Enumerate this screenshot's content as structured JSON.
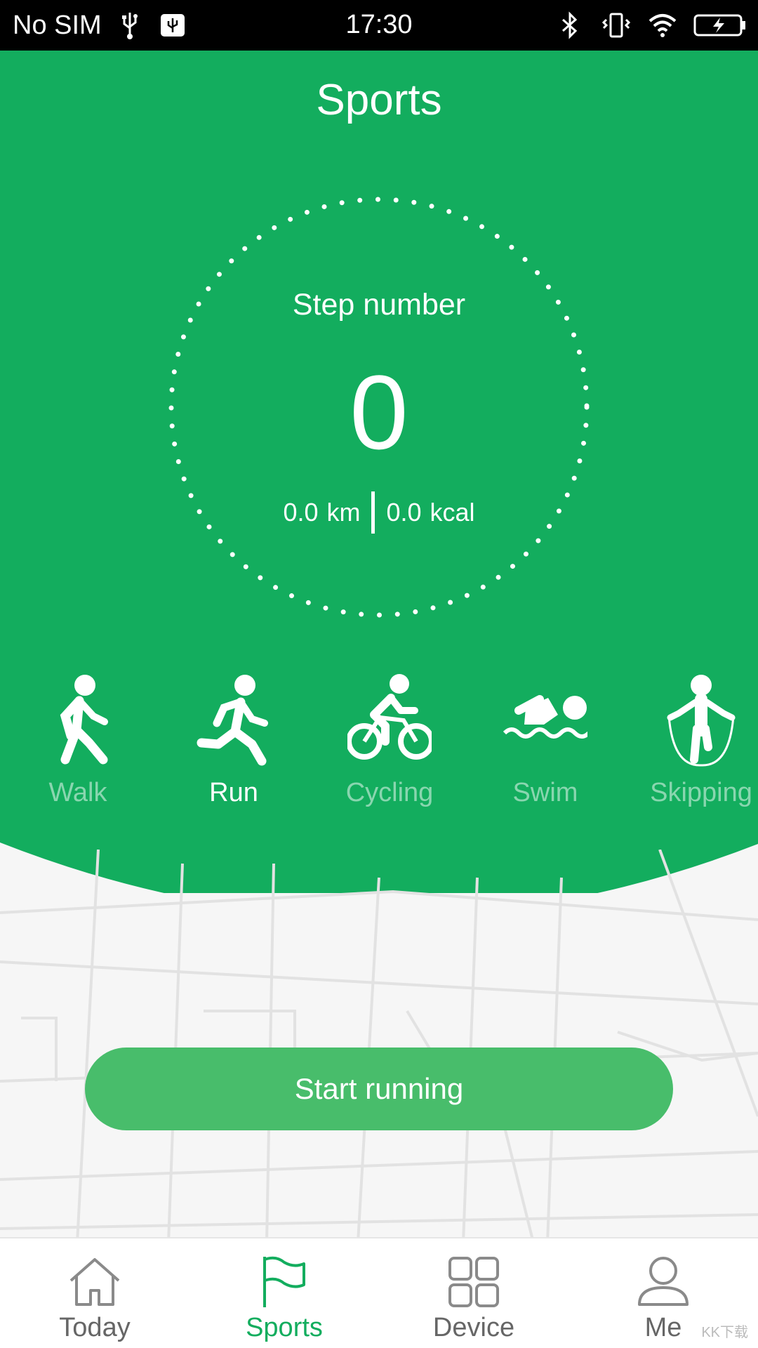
{
  "status_bar": {
    "carrier": "No SIM",
    "time": "17:30"
  },
  "colors": {
    "primary_green": "#13ad5e",
    "button_green": "#48bd6b",
    "inactive_gray": "#666666"
  },
  "header": {
    "title": "Sports"
  },
  "stats": {
    "label": "Step number",
    "steps": "0",
    "distance_value": "0.0",
    "distance_unit": "km",
    "calories_value": "0.0",
    "calories_unit": "kcal"
  },
  "sports": [
    {
      "label": "Walk",
      "icon": "walk-icon",
      "active": false
    },
    {
      "label": "Run",
      "icon": "run-icon",
      "active": true
    },
    {
      "label": "Cycling",
      "icon": "cycling-icon",
      "active": false
    },
    {
      "label": "Swim",
      "icon": "swim-icon",
      "active": false
    },
    {
      "label": "Skipping",
      "icon": "skipping-icon",
      "active": false
    }
  ],
  "action": {
    "start_label": "Start running"
  },
  "bottom_nav": [
    {
      "label": "Today",
      "icon": "home-icon",
      "active": false
    },
    {
      "label": "Sports",
      "icon": "flag-icon",
      "active": true
    },
    {
      "label": "Device",
      "icon": "grid-icon",
      "active": false
    },
    {
      "label": "Me",
      "icon": "person-icon",
      "active": false
    }
  ],
  "watermark": "KK下载"
}
